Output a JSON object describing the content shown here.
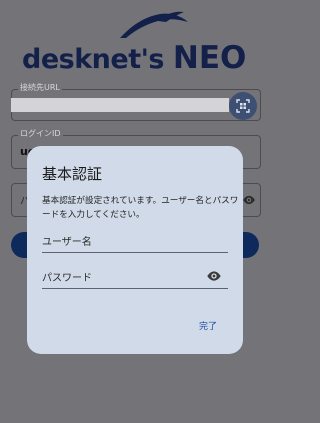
{
  "brand": {
    "word": "desknet",
    "apostrophe": "'",
    "s": "s",
    "neo": "NEO"
  },
  "form": {
    "url_label": "接続先URL",
    "login_label": "ログインID",
    "login_value": "ue",
    "password_visible_fragment": "パ"
  },
  "dialog": {
    "title": "基本認証",
    "message": "基本認証が設定されています。ユーザー名とパスワードを入力してください。",
    "username_placeholder": "ユーザー名",
    "password_placeholder": "パスワード",
    "done_label": "完了"
  },
  "icons": {
    "qr": "qr-scan-icon",
    "eye": "eye-icon"
  },
  "colors": {
    "accent": "#1c4aa6",
    "brand": "#13204a",
    "button": "#0e2a5c"
  }
}
